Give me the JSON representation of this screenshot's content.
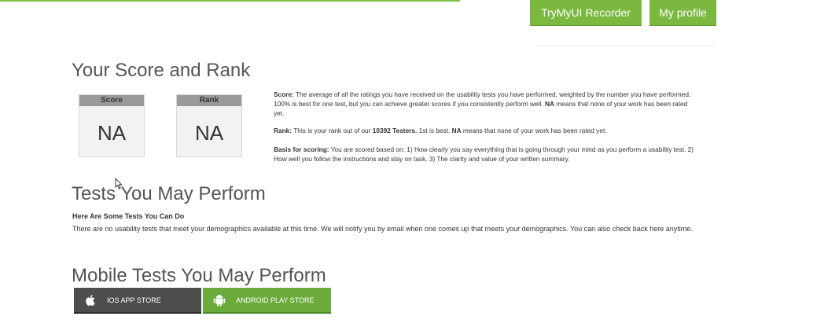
{
  "header": {
    "recorder_label": "TryMyUI Recorder",
    "profile_label": "My profile"
  },
  "score_section": {
    "title": "Your Score and Rank",
    "score_card": {
      "label": "Score",
      "value": "NA"
    },
    "rank_card": {
      "label": "Rank",
      "value": "NA"
    },
    "score_desc": {
      "term": "Score:",
      "text_1": " The average of all the ratings you have received on the usability tests you have performed, weighted by the number you have performed. 100% is best for one test, but you can achieve greater scores if you consistently perform well. ",
      "na": "NA",
      "text_2": " means that none of your work has been rated yet."
    },
    "rank_desc": {
      "term": "Rank:",
      "text_1": " This is your rank out of our ",
      "testers": "10392 Testers.",
      "text_2": " 1st is best. ",
      "na": "NA",
      "text_3": " means that none of your work has been rated yet."
    },
    "basis_desc": {
      "term": "Basis for scoring:",
      "text": " You are scored based on: 1) How clearly you say everything that is going through your mind as you perform a usability test. 2) How well you follow the instructions and stay on task. 3) The clarity and value of your written summary."
    }
  },
  "tests_section": {
    "title": "Tests You May Perform",
    "subtitle": "Here Are Some Tests You Can Do",
    "message": "There are no usability tests that meet your demographics available at this time. We will notify you by email when one comes up that meets your demographics. You can also check back here anytime."
  },
  "mobile_section": {
    "title": "Mobile Tests You May Perform",
    "ios_label": "IOS APP STORE",
    "android_label": "ANDROID PLAY STORE"
  },
  "icons": {
    "apple": "apple-icon",
    "android": "android-icon",
    "cursor": "mouse-cursor-icon"
  },
  "colors": {
    "accent_green": "#7bb840",
    "ios_dark": "#4d4d4d",
    "android_green": "#6aab3b"
  }
}
